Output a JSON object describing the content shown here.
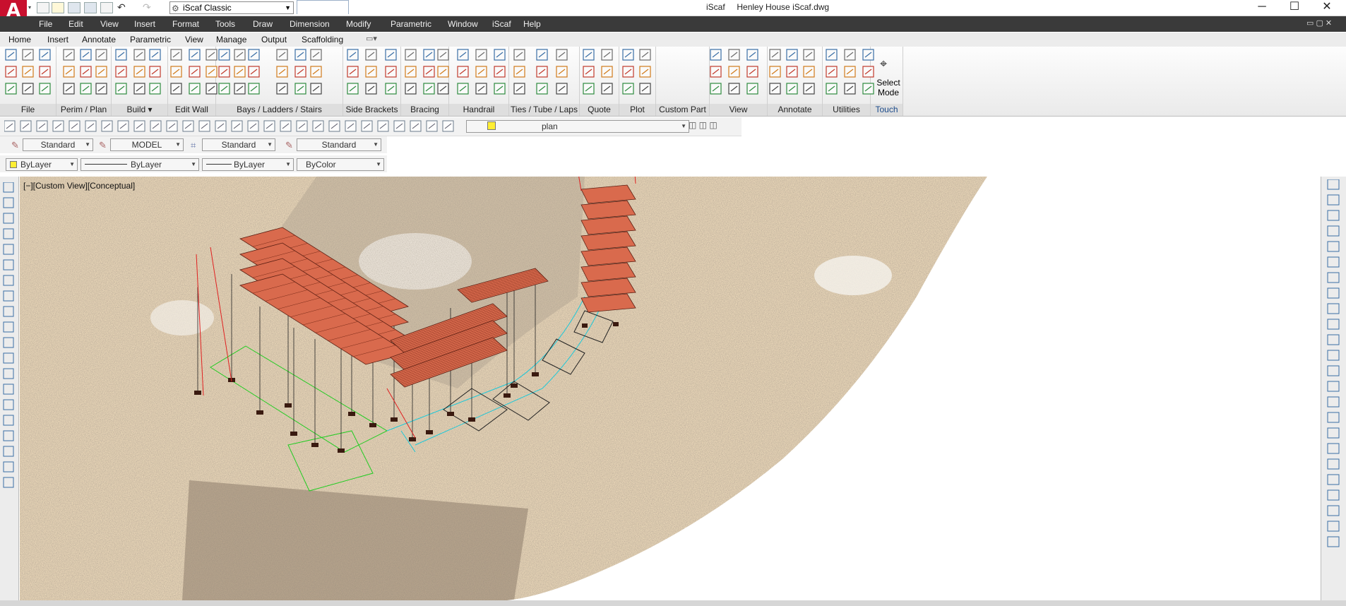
{
  "window": {
    "app_logo": "A",
    "workspace": "iScaf Classic",
    "title_app": "iScaf",
    "title_file": "Henley House iScaf.dwg"
  },
  "menu": [
    "File",
    "Edit",
    "View",
    "Insert",
    "Format",
    "Tools",
    "Draw",
    "Dimension",
    "Modify",
    "Parametric",
    "Window",
    "iScaf",
    "Help"
  ],
  "ribbon_tabs": [
    "Home",
    "Insert",
    "Annotate",
    "Parametric",
    "View",
    "Manage",
    "Output",
    "Scaffolding"
  ],
  "active_tab": "Scaffolding",
  "panels": [
    "File",
    "Perim / Plan",
    "Build",
    "Edit Wall",
    "Bays / Ladders / Stairs",
    "Side Brackets",
    "Bracing",
    "Handrail",
    "Ties / Tube / Laps",
    "Quote",
    "Plot",
    "Custom Part",
    "View",
    "Annotate",
    "Utilities",
    "Touch"
  ],
  "select_mode": {
    "line1": "Select",
    "line2": "Mode"
  },
  "toolbar": {
    "layer": "plan",
    "text_style": "Standard",
    "model": "MODEL",
    "dim_style": "Standard",
    "table_style": "Standard",
    "color": "ByLayer",
    "linetype": "ByLayer",
    "lineweight": "ByLayer",
    "plotstyle": "ByColor"
  },
  "viewport_label": "[−][Custom View][Conceptual]",
  "colors": {
    "accent": "#c8102e",
    "menu_bg": "#3a3a3a",
    "deck": "#d96a4d",
    "scaffold_red": "#e02020",
    "guide_green": "#22cc22",
    "guide_cyan": "#1ec8d8"
  }
}
